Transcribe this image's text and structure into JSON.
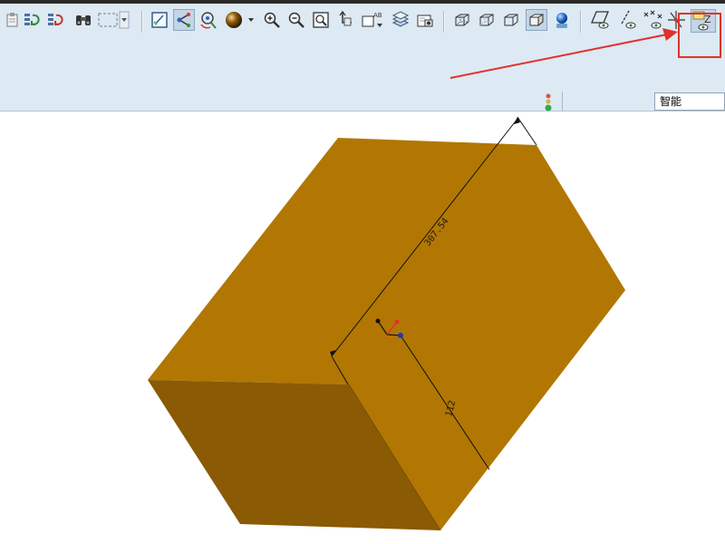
{
  "toolbar": {
    "buttons": [
      {
        "icon": "clipboard-icon"
      },
      {
        "icon": "regenerate-icon"
      },
      {
        "icon": "regenerate-manager-icon"
      },
      {
        "icon": "find-binoculars-icon"
      },
      {
        "icon": "selection-box-icon"
      },
      {
        "icon": "repaint-icon"
      },
      {
        "icon": "spin-center-icon"
      },
      {
        "icon": "orient-mode-icon"
      },
      {
        "icon": "appearance-sphere-icon"
      },
      {
        "icon": "zoom-in-icon"
      },
      {
        "icon": "zoom-out-icon"
      },
      {
        "icon": "refit-icon"
      },
      {
        "icon": "reorient-icon"
      },
      {
        "icon": "saved-views-icon"
      },
      {
        "icon": "layers-icon"
      },
      {
        "icon": "view-manager-icon"
      },
      {
        "icon": "wireframe-icon"
      },
      {
        "icon": "hidden-line-icon"
      },
      {
        "icon": "no-hidden-icon"
      },
      {
        "icon": "shading-icon"
      },
      {
        "icon": "enhanced-realism-icon"
      },
      {
        "icon": "datum-plane-display-icon"
      },
      {
        "icon": "datum-axis-display-icon"
      },
      {
        "icon": "point-display-icon"
      },
      {
        "icon": "csys-display-icon"
      },
      {
        "icon": "annotation-display-icon"
      }
    ],
    "saved_view_label": "AB",
    "annotation_icon_label": "Z"
  },
  "selection_filter": {
    "value": "智能"
  },
  "model": {
    "dimension_long": "307.54",
    "dimension_short": "112",
    "colors": {
      "top_face": "#b27702",
      "right_face": "#b27702",
      "front_face": "#8a5a05",
      "annotation_red": "#e0312b"
    }
  }
}
